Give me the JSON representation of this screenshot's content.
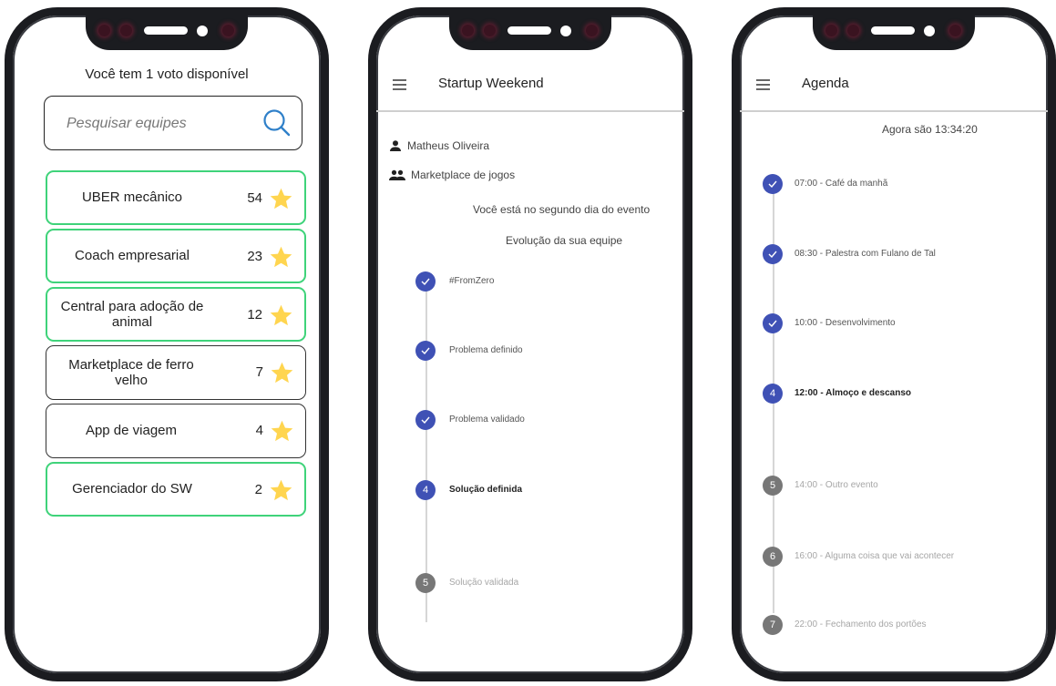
{
  "screen_votes": {
    "title": "Você tem 1 voto disponível",
    "search_placeholder": "Pesquisar equipes",
    "teams": [
      {
        "name": "UBER mecânico",
        "votes": "54",
        "border": "green"
      },
      {
        "name": "Coach empresarial",
        "votes": "23",
        "border": "green"
      },
      {
        "name": "Central para adoção de animal",
        "votes": "12",
        "border": "green"
      },
      {
        "name": "Marketplace de ferro velho",
        "votes": "7",
        "border": "black"
      },
      {
        "name": "App de viagem",
        "votes": "4",
        "border": "black"
      },
      {
        "name": "Gerenciador do SW",
        "votes": "2",
        "border": "green"
      }
    ]
  },
  "screen_team": {
    "title": "Startup Weekend",
    "user_name": "Matheus Oliveira",
    "team_name": "Marketplace de jogos",
    "day_text": "Você está no segundo dia do evento",
    "evolution_title": "Evolução da sua equipe",
    "steps": [
      {
        "label": "#FromZero",
        "status": "done",
        "number": ""
      },
      {
        "label": "Problema definido",
        "status": "done",
        "number": ""
      },
      {
        "label": "Problema validado",
        "status": "done",
        "number": ""
      },
      {
        "label": "Solução definida",
        "status": "active",
        "number": "4"
      },
      {
        "label": "Solução validada",
        "status": "pending",
        "number": "5"
      }
    ]
  },
  "screen_agenda": {
    "title": "Agenda",
    "now_text": "Agora são 13:34:20",
    "events": [
      {
        "label": "07:00 - Café da manhã",
        "status": "done",
        "number": ""
      },
      {
        "label": "08:30 - Palestra com Fulano de Tal",
        "status": "done",
        "number": ""
      },
      {
        "label": "10:00 - Desenvolvimento",
        "status": "done",
        "number": ""
      },
      {
        "label": "12:00 - Almoço e descanso",
        "status": "active",
        "number": "4"
      },
      {
        "label": "14:00 - Outro evento",
        "status": "pending",
        "number": "5"
      },
      {
        "label": "16:00 - Alguma coisa que vai acontecer",
        "status": "pending",
        "number": "6"
      },
      {
        "label": "22:00 - Fechamento dos portões",
        "status": "pending",
        "number": "7"
      }
    ]
  },
  "colors": {
    "green_border": "#3fd37a",
    "step_blue": "#3f51b5",
    "step_gray": "#777777",
    "star": "#ffd54f",
    "search_icon": "#2f80c9"
  }
}
